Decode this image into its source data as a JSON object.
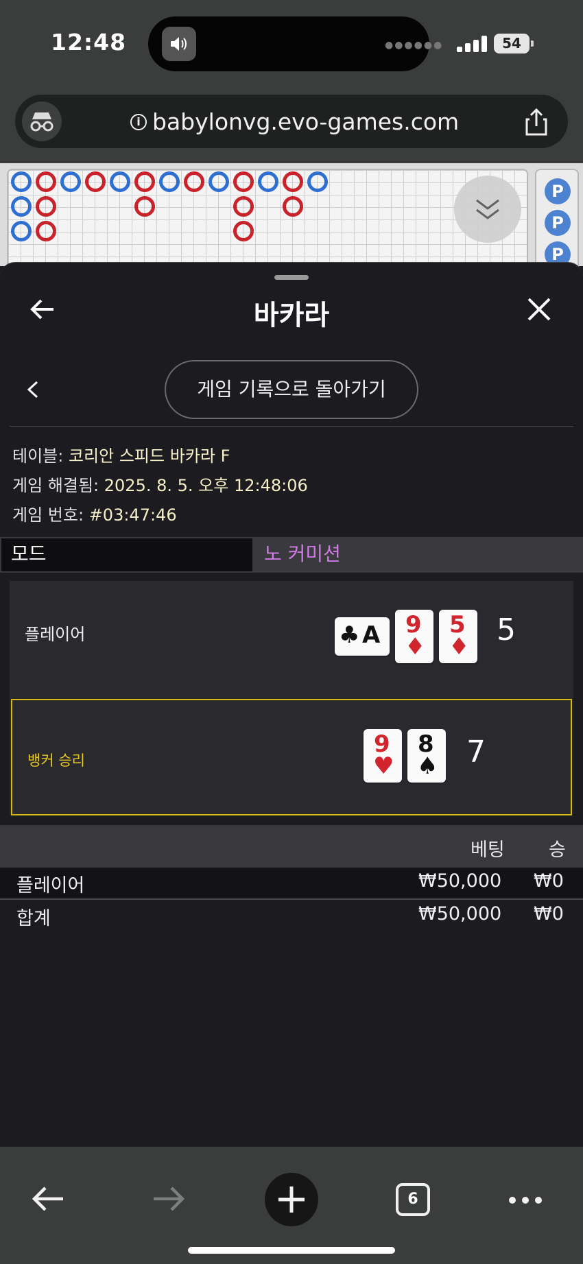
{
  "status_bar": {
    "time": "12:48",
    "battery": "54"
  },
  "browser": {
    "url": "babylonvg.evo-games.com",
    "tab_count": "6"
  },
  "road": {
    "row1": [
      "P",
      "B",
      "P",
      "B",
      "P",
      "B",
      "P",
      "B",
      "P",
      "B",
      "P",
      "B",
      "P"
    ],
    "row2": [
      "P",
      "B",
      "",
      "",
      "",
      "B",
      "",
      "",
      "",
      "B",
      "",
      "B",
      ""
    ],
    "row3": [
      "P",
      "B",
      "",
      "",
      "",
      "",
      "",
      "",
      "",
      "B",
      "",
      "",
      ""
    ],
    "side_chip": "P"
  },
  "sheet": {
    "title": "바카라",
    "history_button": "게임 기록으로 돌아가기",
    "table_label": "테이블:",
    "table_value": "코리안 스피드 바카라 F",
    "resolved_label": "게임 해결됨:",
    "resolved_value": "2025. 8. 5. 오후 12:48:06",
    "game_no_label": "게임 번호:",
    "game_no_value": "#03:47:46",
    "mode_label": "모드",
    "mode_value": "노 커미션"
  },
  "result": {
    "player_label": "플레이어",
    "player_score": "5",
    "player_cards": [
      {
        "rank": "A",
        "suit": "♣",
        "color": "black",
        "rotated": true
      },
      {
        "rank": "9",
        "suit": "♦",
        "color": "red"
      },
      {
        "rank": "5",
        "suit": "♦",
        "color": "red"
      }
    ],
    "banker_label": "뱅커 승리",
    "banker_score": "7",
    "banker_cards": [
      {
        "rank": "9",
        "suit": "♥",
        "color": "red"
      },
      {
        "rank": "8",
        "suit": "♠",
        "color": "black"
      }
    ]
  },
  "bets": {
    "col_bet": "베팅",
    "col_win": "승",
    "rows": [
      {
        "label": "플레이어",
        "bet": "₩50,000",
        "win": "₩0"
      },
      {
        "label": "합계",
        "bet": "₩50,000",
        "win": "₩0"
      }
    ]
  },
  "colors": {
    "player_blue": "#2f6fd1",
    "banker_red": "#c8222b",
    "win_gold": "#d9b914",
    "mode_purple": "#d07ae6"
  }
}
